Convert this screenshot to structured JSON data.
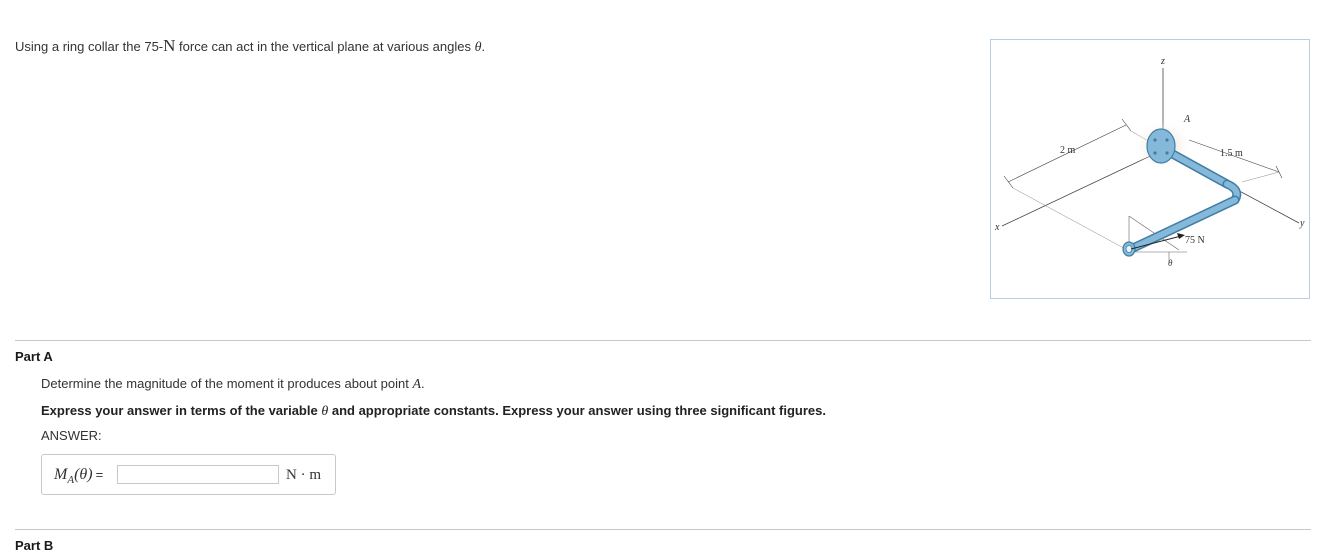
{
  "intro": {
    "text_before": "Using a ring collar the 75-",
    "unit": "N",
    "text_after": " force can act in the vertical plane at various angles ",
    "theta": "θ",
    "period": "."
  },
  "figure": {
    "label_z": "z",
    "label_x": "x",
    "label_y": "y",
    "label_a": "A",
    "dim_2m": "2 m",
    "dim_15m": "1.5 m",
    "force_label": "75 N",
    "angle_label": "θ",
    "pipe_color": "#86b9d9",
    "pipe_outline": "#3f7ea6"
  },
  "part_a": {
    "title": "Part A",
    "question_before": "Determine the magnitude of the moment it produces about point ",
    "point": "A",
    "question_after": ".",
    "instruction_before": "Express your answer in terms of the variable ",
    "instruction_theta": "θ",
    "instruction_after": " and appropriate constants. Express your answer using three significant figures.",
    "answer_label": "ANSWER:",
    "lhs_symbol": "M",
    "lhs_subscript": "A",
    "lhs_arg": "(θ)",
    "lhs_eq": "=",
    "input_value": "",
    "unit": "N · m"
  },
  "part_b": {
    "title": "Part B"
  }
}
